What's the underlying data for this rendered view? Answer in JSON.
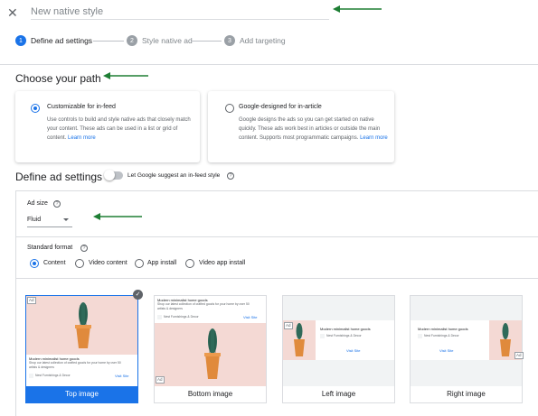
{
  "header": {
    "close_icon": "close-icon",
    "title_placeholder": "New native style"
  },
  "steps": [
    {
      "num": "1",
      "label": "Define ad settings"
    },
    {
      "num": "2",
      "label": "Style native ad"
    },
    {
      "num": "3",
      "label": "Add targeting"
    }
  ],
  "path": {
    "heading": "Choose your path",
    "options": [
      {
        "title": "Customizable for in-feed",
        "desc": "Use controls to build and style native ads that closely match your content. These ads can be used in a list or grid of content.",
        "link": "Learn more"
      },
      {
        "title": "Google-designed for in-article",
        "desc": "Google designs the ads so you can get started on native quickly. These ads work best in articles or outside the main content. Supports most programmatic campaigns.",
        "link": "Learn more"
      }
    ]
  },
  "settings": {
    "heading": "Define ad settings",
    "toggle_label": "Let Google suggest an in-feed style",
    "ad_size_label": "Ad size",
    "ad_size_value": "Fluid",
    "standard_format_label": "Standard format",
    "formats": [
      "Content",
      "Video content",
      "App install",
      "Video app install"
    ],
    "selected_format": "Content"
  },
  "layouts": [
    {
      "caption": "Top image"
    },
    {
      "caption": "Bottom image"
    },
    {
      "caption": "Left image"
    },
    {
      "caption": "Right image"
    }
  ],
  "preview": {
    "ad_badge": "Ad",
    "headline": "Modern minimalist home goods",
    "body": "Shop our latest collection of crafted goods for your home by over 50 artists & designers",
    "advertiser": "Nest Furnishings & Decor",
    "cta": "Visit Site"
  },
  "colors": {
    "accent": "#1a73e8",
    "arrow": "#1e7e34"
  }
}
